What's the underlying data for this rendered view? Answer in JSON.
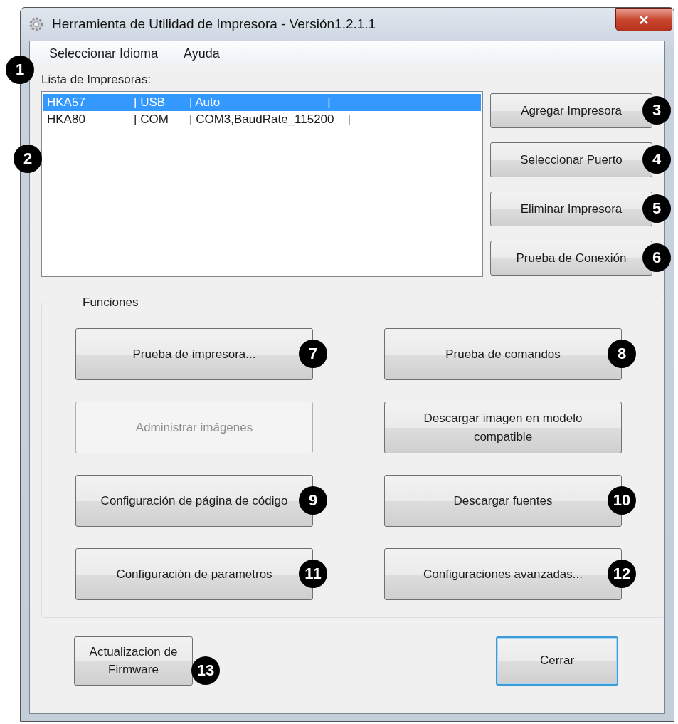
{
  "window": {
    "title": "Herramienta de Utilidad de Impresora - Versión1.2.1.1"
  },
  "menu": [
    {
      "label": "Seleccionar Idioma"
    },
    {
      "label": "Ayuda"
    }
  ],
  "printer_list": {
    "label": "Lista de Impresoras:",
    "callout": "2",
    "rows": [
      {
        "cells": [
          "HKA57",
          "| USB",
          "| Auto                                |"
        ],
        "selected": true
      },
      {
        "cells": [
          "HKA80",
          "| COM",
          "| COM3,BaudRate_115200    |"
        ],
        "selected": false
      }
    ]
  },
  "printer_buttons": [
    {
      "label": "Agregar Impresora",
      "callout": "3"
    },
    {
      "label": "Seleccionar Puerto",
      "callout": "4"
    },
    {
      "label": "Eliminar Impresora",
      "callout": "5"
    },
    {
      "label": "Prueba de Conexión",
      "callout": "6"
    }
  ],
  "functions": {
    "title": "Funciones",
    "buttons": [
      {
        "label": "Prueba de impresora...",
        "disabled": false,
        "callout": "7"
      },
      {
        "label": "Prueba de comandos",
        "disabled": false,
        "callout": "8"
      },
      {
        "label": "Administrar imágenes",
        "disabled": true
      },
      {
        "label": "Descargar imagen en modelo compatible",
        "disabled": false
      },
      {
        "label": "Configuración de página de código",
        "disabled": false,
        "callout": "9"
      },
      {
        "label": "Descargar fuentes",
        "disabled": false,
        "callout": "10"
      },
      {
        "label": "Configuración de parametros",
        "disabled": false,
        "callout": "11"
      },
      {
        "label": "Configuraciones avanzadas...",
        "disabled": false,
        "callout": "12"
      }
    ]
  },
  "bottom_buttons": [
    {
      "label": "Actualizacion de Firmware",
      "default": false,
      "callout": "13"
    },
    {
      "label": "Cerrar",
      "default": true
    }
  ],
  "menu_callout": "1"
}
